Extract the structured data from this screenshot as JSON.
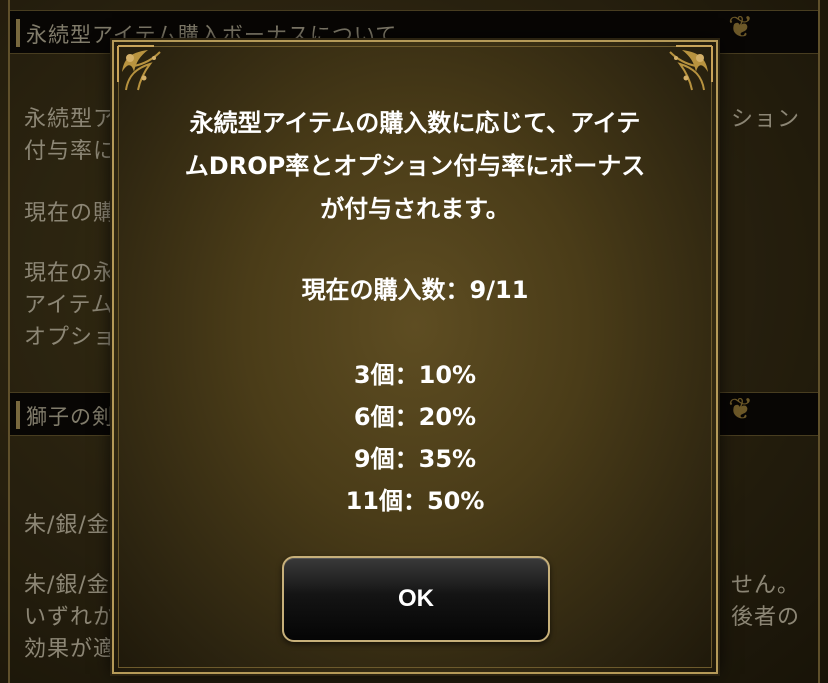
{
  "background": {
    "section1_header": "永続型アイテム購入ボーナスについて",
    "section1_lines": [
      "永続型ア",
      "付与率に",
      "現在の購",
      "現在の永",
      "アイテム",
      "オプショ"
    ],
    "section1_right": "ション",
    "section2_header": "獅子の剣",
    "section2_lines": [
      "朱/銀/金",
      "朱/銀/金",
      "いずれか",
      "効果が適"
    ],
    "section2_right_1": "せん。",
    "section2_right_2": "後者の"
  },
  "modal": {
    "desc_line1": "永続型アイテムの購入数に応じて、アイテ",
    "desc_line2": "ムDROP率とオプション付与率にボーナス",
    "desc_line3": "が付与されます。",
    "count_label": "現在の購入数：9/11",
    "tiers": [
      "3個：10%",
      "6個：20%",
      "9個：35%",
      "11個：50%"
    ],
    "ok_label": "OK"
  },
  "colors": {
    "frame_gold": "#b59a58",
    "text_white": "#ffffff",
    "button_dark": "#050505"
  }
}
